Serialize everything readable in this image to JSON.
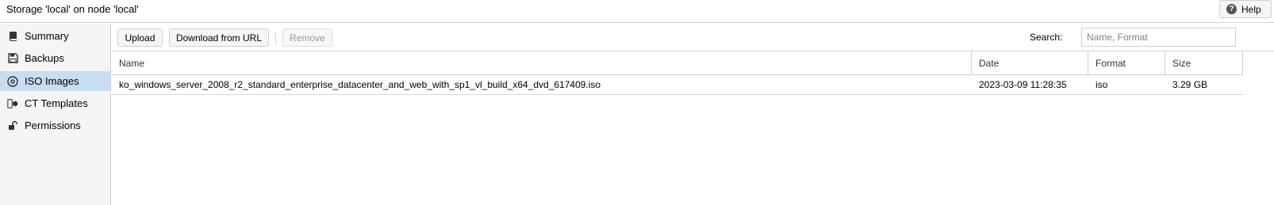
{
  "header": {
    "title": "Storage 'local' on node 'local'",
    "help_label": "Help"
  },
  "sidebar": {
    "items": [
      {
        "label": "Summary",
        "icon": "book-icon",
        "active": false
      },
      {
        "label": "Backups",
        "icon": "floppy-icon",
        "active": false
      },
      {
        "label": "ISO Images",
        "icon": "disc-icon",
        "active": true
      },
      {
        "label": "CT Templates",
        "icon": "templates-icon",
        "active": false
      },
      {
        "label": "Permissions",
        "icon": "unlock-icon",
        "active": false
      }
    ]
  },
  "toolbar": {
    "upload_label": "Upload",
    "download_label": "Download from URL",
    "remove_label": "Remove",
    "search_label": "Search:",
    "search_placeholder": "Name, Format",
    "search_value": ""
  },
  "table": {
    "columns": [
      "Name",
      "Date",
      "Format",
      "Size"
    ],
    "rows": [
      {
        "name": "ko_windows_server_2008_r2_standard_enterprise_datacenter_and_web_with_sp1_vl_build_x64_dvd_617409.iso",
        "date": "2023-03-09 11:28:35",
        "format": "iso",
        "size": "3.29 GB"
      }
    ]
  },
  "colors": {
    "active_nav": "#c7ddf1",
    "sidebar_bg": "#f5f5f5",
    "border": "#cfcfcf"
  }
}
